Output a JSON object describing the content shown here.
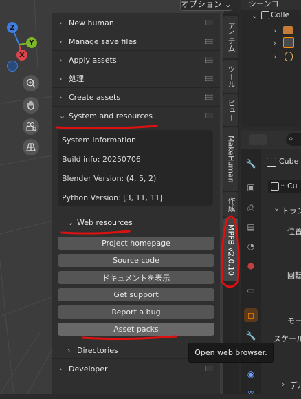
{
  "header": {
    "options_label": "オプション ⌄"
  },
  "gizmo": {
    "z": "Z",
    "y": "Y",
    "x": "X"
  },
  "npanel": {
    "sections": [
      {
        "label": "New human"
      },
      {
        "label": "Manage save files"
      },
      {
        "label": "Apply assets"
      },
      {
        "label": "処理"
      },
      {
        "label": "Create assets"
      },
      {
        "label": "System and resources"
      }
    ],
    "system_info": {
      "title": "System information",
      "build": "Build info: 20250706",
      "blender": "Blender Version: (4, 5, 2)",
      "python": "Python Version: [3, 11, 11]"
    },
    "web_resources": {
      "label": "Web resources",
      "buttons": [
        {
          "label": "Project homepage"
        },
        {
          "label": "Source code"
        },
        {
          "label": "ドキュメントを表示"
        },
        {
          "label": "Get support"
        },
        {
          "label": "Report a bug"
        },
        {
          "label": "Asset packs"
        }
      ]
    },
    "directories_label": "Directories",
    "developer_label": "Developer"
  },
  "tabs": [
    {
      "label": "アイテム"
    },
    {
      "label": "ツール"
    },
    {
      "label": "ビュー"
    },
    {
      "label": "MakeHuman"
    },
    {
      "label": "作成"
    },
    {
      "label": "MPFB v2.0.10"
    }
  ],
  "outliner": {
    "scene": "シーンコ",
    "collection": "Colle"
  },
  "properties": {
    "object_name": "Cube",
    "object_name_field": "Cu",
    "transform": "トラン",
    "location": "位置",
    "rotation": "回転",
    "mode": "モー",
    "scale": "スケール",
    "delta": "デル"
  },
  "tooltip": {
    "text": "Open web browser."
  },
  "colors": {
    "annotation": "#e01010",
    "accent": "#ff8b00"
  }
}
